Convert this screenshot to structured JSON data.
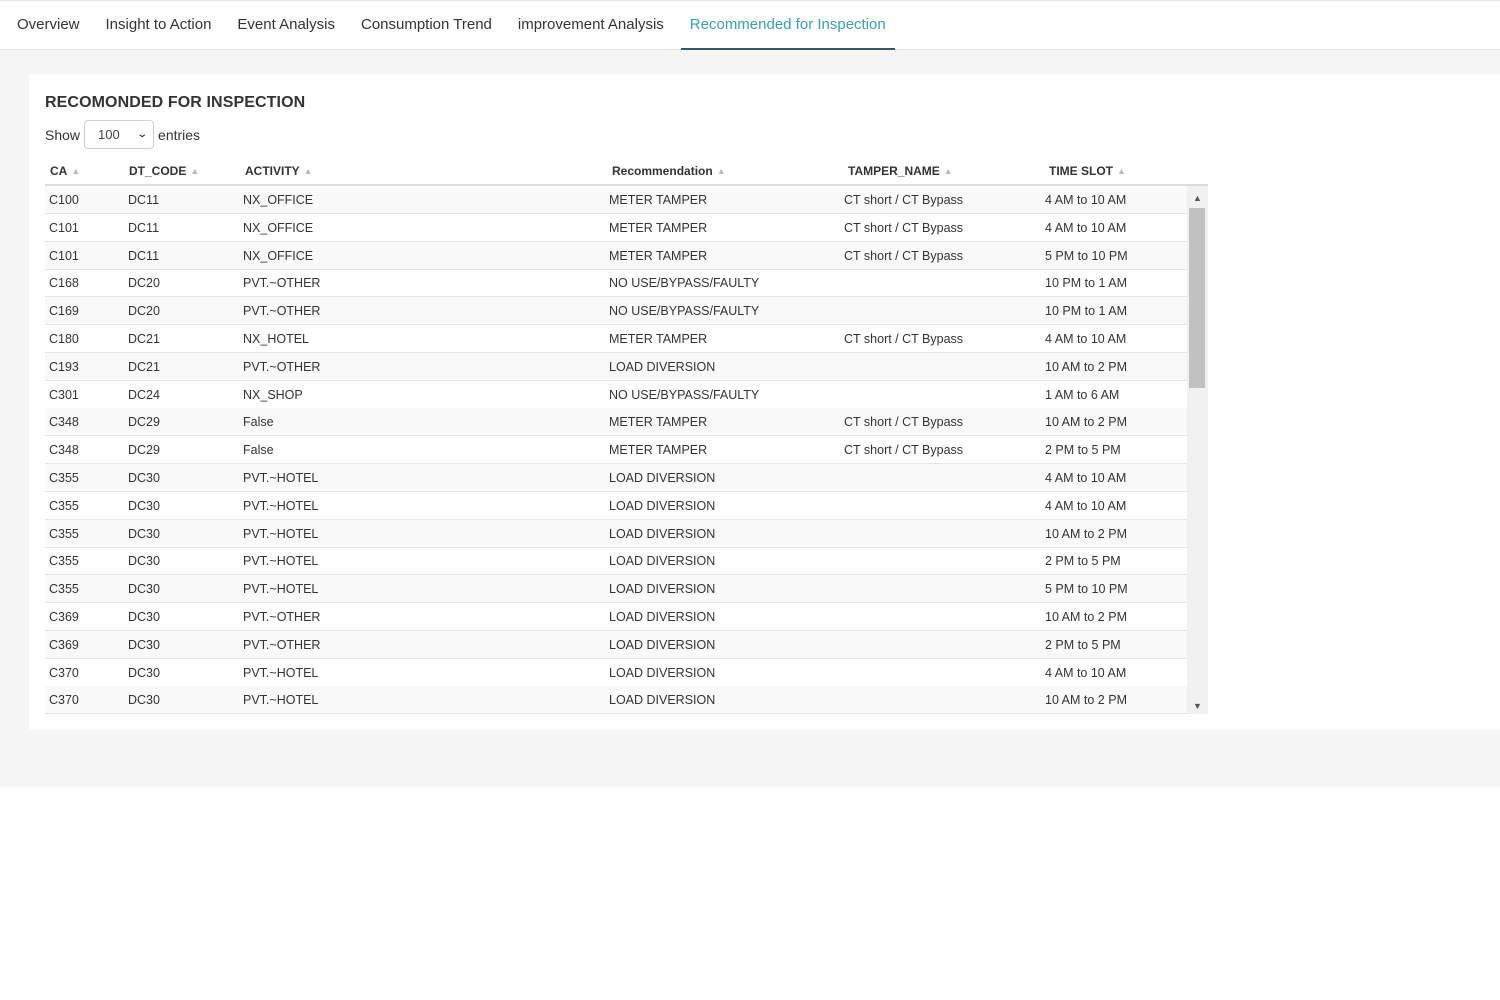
{
  "tabs": [
    {
      "label": "Overview"
    },
    {
      "label": "Insight to Action"
    },
    {
      "label": "Event Analysis"
    },
    {
      "label": "Consumption Trend"
    },
    {
      "label": "improvement Analysis"
    },
    {
      "label": "Recommended for Inspection",
      "active": true
    }
  ],
  "card": {
    "title": "RECOMONDED FOR INSPECTION",
    "show_label": "Show",
    "entries_value": "100",
    "entries_label": "entries"
  },
  "table": {
    "columns": [
      "CA",
      "DT_CODE",
      "ACTIVITY",
      "Recommendation",
      "TAMPER_NAME",
      "TIME SLOT"
    ],
    "rows": [
      [
        "C100",
        "DC11",
        "NX_OFFICE",
        "METER TAMPER",
        "CT short / CT Bypass",
        "4 AM to 10 AM"
      ],
      [
        "C101",
        "DC11",
        "NX_OFFICE",
        "METER TAMPER",
        "CT short / CT Bypass",
        "4 AM to 10 AM"
      ],
      [
        "C101",
        "DC11",
        "NX_OFFICE",
        "METER TAMPER",
        "CT short / CT Bypass",
        "5 PM to 10 PM"
      ],
      [
        "C168",
        "DC20",
        "PVT.~OTHER",
        "NO USE/BYPASS/FAULTY",
        "",
        "10 PM to 1 AM"
      ],
      [
        "C169",
        "DC20",
        "PVT.~OTHER",
        "NO USE/BYPASS/FAULTY",
        "",
        "10 PM to 1 AM"
      ],
      [
        "C180",
        "DC21",
        "NX_HOTEL",
        "METER TAMPER",
        "CT short / CT Bypass",
        "4 AM to 10 AM"
      ],
      [
        "C193",
        "DC21",
        "PVT.~OTHER",
        "LOAD DIVERSION",
        "",
        "10 AM to 2 PM"
      ],
      [
        "C301",
        "DC24",
        "NX_SHOP",
        "NO USE/BYPASS/FAULTY",
        "",
        "1 AM to 6 AM"
      ],
      [
        "C348",
        "DC29",
        "False",
        "METER TAMPER",
        "CT short / CT Bypass",
        "10 AM to 2 PM"
      ],
      [
        "C348",
        "DC29",
        "False",
        "METER TAMPER",
        "CT short / CT Bypass",
        "2 PM to 5 PM"
      ],
      [
        "C355",
        "DC30",
        "PVT.~HOTEL",
        "LOAD DIVERSION",
        "",
        "4 AM to 10 AM"
      ],
      [
        "C355",
        "DC30",
        "PVT.~HOTEL",
        "LOAD DIVERSION",
        "",
        "4 AM to 10 AM"
      ],
      [
        "C355",
        "DC30",
        "PVT.~HOTEL",
        "LOAD DIVERSION",
        "",
        "10 AM to 2 PM"
      ],
      [
        "C355",
        "DC30",
        "PVT.~HOTEL",
        "LOAD DIVERSION",
        "",
        "2 PM to 5 PM"
      ],
      [
        "C355",
        "DC30",
        "PVT.~HOTEL",
        "LOAD DIVERSION",
        "",
        "5 PM to 10 PM"
      ],
      [
        "C369",
        "DC30",
        "PVT.~OTHER",
        "LOAD DIVERSION",
        "",
        "10 AM to 2 PM"
      ],
      [
        "C369",
        "DC30",
        "PVT.~OTHER",
        "LOAD DIVERSION",
        "",
        "2 PM to 5 PM"
      ],
      [
        "C370",
        "DC30",
        "PVT.~HOTEL",
        "LOAD DIVERSION",
        "",
        "4 AM to 10 AM"
      ],
      [
        "C370",
        "DC30",
        "PVT.~HOTEL",
        "LOAD DIVERSION",
        "",
        "10 AM to 2 PM"
      ]
    ]
  },
  "icons": {
    "sort": "sort-icon",
    "select_chevron": "chevron-down-icon",
    "scroll_up": "arrow-up-icon",
    "scroll_down": "arrow-down-icon"
  },
  "colors": {
    "active_tab": "#3a9cb8",
    "active_underline": "#3b5569",
    "content_bg": "#f5f5f5"
  }
}
